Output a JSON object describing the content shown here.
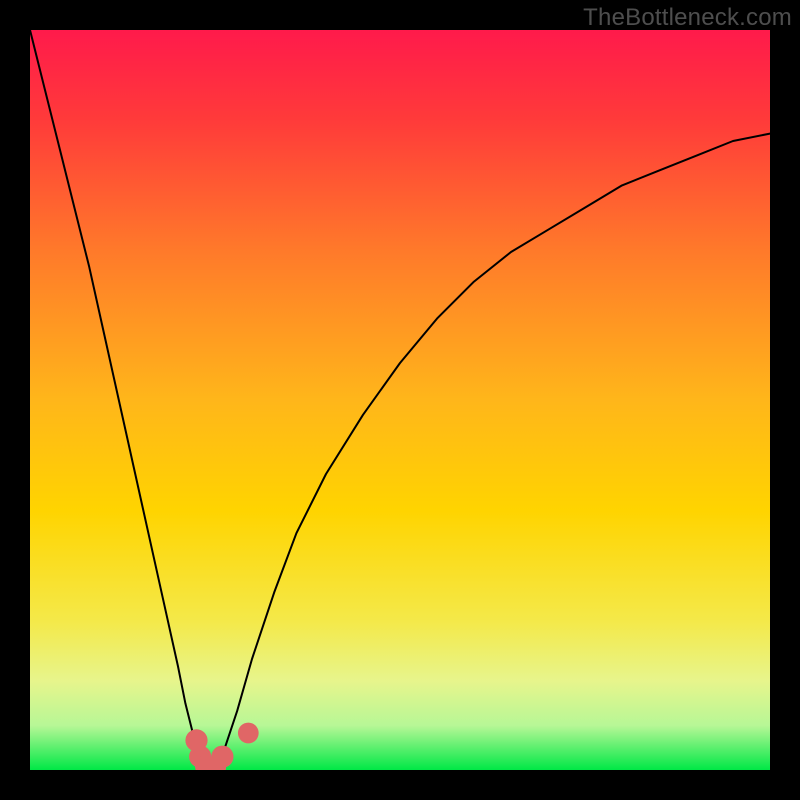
{
  "watermark": "TheBottleneck.com",
  "chart_data": {
    "type": "line",
    "title": "",
    "xlabel": "",
    "ylabel": "",
    "xlim": [
      0,
      100
    ],
    "ylim": [
      0,
      100
    ],
    "grid": false,
    "background_gradient": {
      "top": "#ff1a4b",
      "middle": "#ffd400",
      "bottom": "#00e846"
    },
    "series": [
      {
        "name": "curve-left",
        "x": [
          0,
          2,
          4,
          6,
          8,
          10,
          12,
          14,
          16,
          18,
          20,
          21,
          22,
          23,
          24,
          25,
          26,
          27
        ],
        "y": [
          100,
          92,
          84,
          76,
          68,
          59,
          50,
          41,
          32,
          23,
          14,
          9,
          5,
          2,
          0,
          0,
          1,
          2
        ],
        "stroke": "#000000",
        "stroke_width": 2
      },
      {
        "name": "curve-right",
        "x": [
          24,
          26,
          28,
          30,
          33,
          36,
          40,
          45,
          50,
          55,
          60,
          65,
          70,
          75,
          80,
          85,
          90,
          95,
          100
        ],
        "y": [
          0,
          2,
          8,
          15,
          24,
          32,
          40,
          48,
          55,
          61,
          66,
          70,
          73,
          76,
          79,
          81,
          83,
          85,
          86
        ],
        "stroke": "#000000",
        "stroke_width": 2
      }
    ],
    "markers": [
      {
        "name": "dot-1",
        "x": 22.5,
        "y": 4.0,
        "r": 1.5,
        "fill": "#e06666"
      },
      {
        "name": "dot-2",
        "x": 23.0,
        "y": 1.8,
        "r": 1.5,
        "fill": "#e06666"
      },
      {
        "name": "dot-3",
        "x": 23.8,
        "y": 0.5,
        "r": 1.5,
        "fill": "#e06666"
      },
      {
        "name": "dot-4",
        "x": 25.0,
        "y": 0.4,
        "r": 1.5,
        "fill": "#e06666"
      },
      {
        "name": "dot-5",
        "x": 26.0,
        "y": 1.8,
        "r": 1.5,
        "fill": "#e06666"
      },
      {
        "name": "dot-6",
        "x": 29.5,
        "y": 5.0,
        "r": 1.4,
        "fill": "#e06666"
      }
    ],
    "green_band": {
      "y": 2.5,
      "height": 5
    }
  }
}
